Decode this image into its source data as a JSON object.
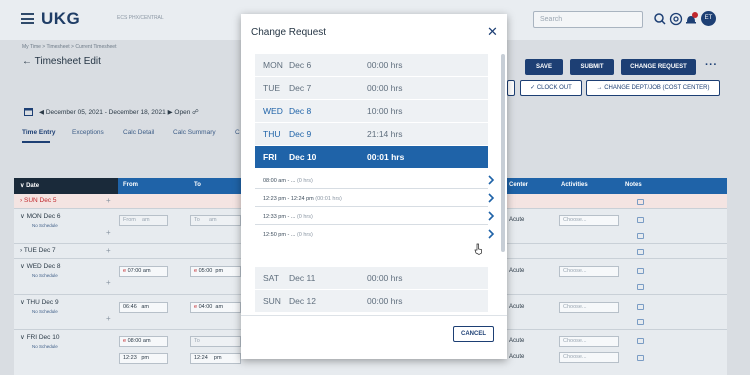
{
  "header": {
    "logo": "UKG",
    "environment": "ECS PHX/CENTRAL",
    "search_placeholder": "Search",
    "avatar_initials": "ET"
  },
  "breadcrumb": "My Time > Timesheet > Current Timesheet",
  "page_title": "Timesheet Edit",
  "actions": {
    "save": "SAVE",
    "submit": "SUBMIT",
    "change_request": "CHANGE REQUEST",
    "more": "···",
    "clock_out": "CLOCK OUT",
    "change_dept": "CHANGE DEPT/JOB (COST CENTER)"
  },
  "period": {
    "range": "December 05, 2021 - December 18, 2021",
    "status": "Open"
  },
  "tabs": [
    "Time Entry",
    "Exceptions",
    "Calc Detail",
    "Calc Summary",
    "C"
  ],
  "grid": {
    "columns": {
      "date": "Date",
      "from": "From",
      "to": "To",
      "center": "Center",
      "activities": "Activities",
      "notes": "Notes"
    },
    "rows": [
      {
        "date": "SUN Dec 5",
        "sub": ""
      },
      {
        "date": "MON Dec 6",
        "sub": "No Schedule",
        "from": "From",
        "from_ampm": "am",
        "to": "To",
        "to_ampm": "am"
      },
      {
        "date": "TUE Dec 7",
        "sub": ""
      },
      {
        "date": "WED Dec 8",
        "sub": "No Schedule",
        "from": "07:00",
        "from_ampm": "am",
        "to": "05:00",
        "to_ampm": "pm"
      },
      {
        "date": "THU Dec 9",
        "sub": "No Schedule",
        "from": "06:46",
        "from_ampm": "am",
        "to": "04:00",
        "to_ampm": "am"
      },
      {
        "date": "FRI Dec 10",
        "sub": "No Schedule",
        "from": "08:00",
        "from_ampm": "am",
        "to": "To",
        "to_ampm": "",
        "from2": "12:23",
        "from2_ampm": "pm",
        "to2": "12:24",
        "to2_ampm": "pm"
      }
    ],
    "center_value": "Acute",
    "activities_placeholder": "Choose..."
  },
  "modal": {
    "title": "Change Request",
    "cancel": "CANCEL",
    "days_before": [
      {
        "name": "MON",
        "date": "Dec 6",
        "hours": "00:00 hrs",
        "muted": true
      },
      {
        "name": "TUE",
        "date": "Dec 7",
        "hours": "00:00 hrs",
        "muted": true
      },
      {
        "name": "WED",
        "date": "Dec 8",
        "hours": "10:00 hrs",
        "muted": false
      },
      {
        "name": "THU",
        "date": "Dec 9",
        "hours": "21:14 hrs",
        "muted": false
      },
      {
        "name": "FRI",
        "date": "Dec 10",
        "hours": "00:01 hrs",
        "selected": true
      }
    ],
    "punches": [
      {
        "range": "08:00 am - ...",
        "duration": "(0 hrs)"
      },
      {
        "range": "12:23 pm - 12:24 pm",
        "duration": "(00:01 hrs)"
      },
      {
        "range": "12:33 pm - ...",
        "duration": "(0 hrs)"
      },
      {
        "range": "12:50 pm - ...",
        "duration": "(0 hrs)"
      }
    ],
    "days_after": [
      {
        "name": "SAT",
        "date": "Dec 11",
        "hours": "00:00 hrs"
      },
      {
        "name": "SUN",
        "date": "Dec 12",
        "hours": "00:00 hrs"
      }
    ]
  },
  "colors": {
    "primary": "#1d3f74",
    "grid_header": "#1f63a8",
    "selected_day": "#1f63a8",
    "notification": "#c0282d"
  }
}
